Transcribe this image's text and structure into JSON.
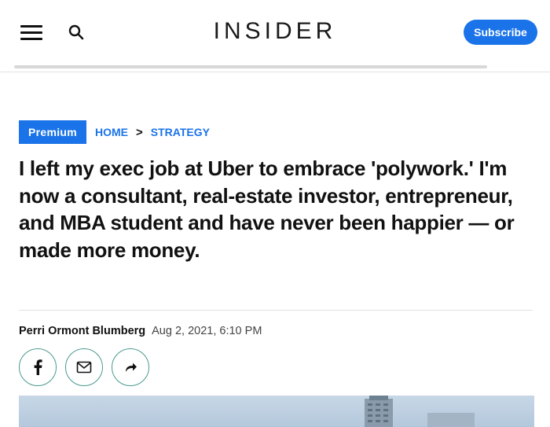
{
  "header": {
    "logo": "INSIDER",
    "subscribe_label": "Subscribe",
    "menu_icon": "hamburger-menu-icon",
    "search_icon": "search-icon",
    "accent_color": "#1a73e8"
  },
  "article": {
    "badge": "Premium",
    "breadcrumb": {
      "home": "HOME",
      "separator": ">",
      "section": "STRATEGY"
    },
    "headline": "I left my exec job at Uber to embrace 'polywork.' I'm now a consultant, real-estate investor, entrepreneur, and MBA student and have never been happier — or made more money.",
    "author": "Perri Ormont Blumberg",
    "date": "Aug 2, 2021, 6:10 PM",
    "share_buttons": [
      {
        "icon": "facebook-icon"
      },
      {
        "icon": "email-icon"
      },
      {
        "icon": "share-forward-icon"
      }
    ]
  }
}
